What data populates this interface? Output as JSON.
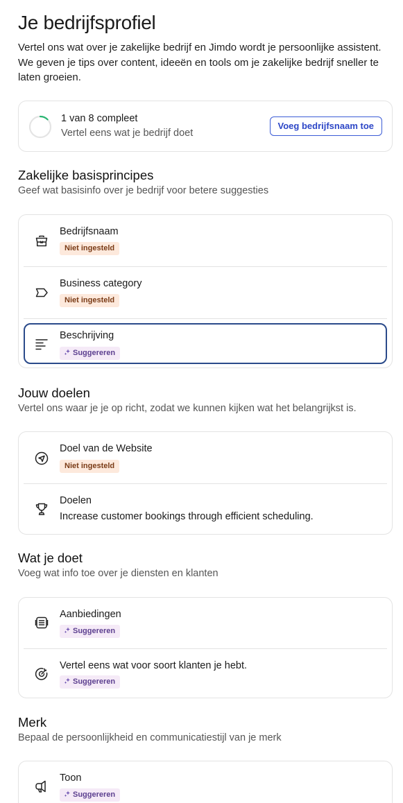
{
  "header": {
    "title": "Je bedrijfsprofiel",
    "intro": "Vertel ons wat over je zakelijke bedrijf en Jimdo wordt je persoonlijke assistent. We geven je tips over content, ideeën en tools om je zakelijke bedrijf sneller te laten groeien."
  },
  "progress": {
    "title": "1 van 8 compleet",
    "subtitle": "Vertel eens wat je bedrijf doet",
    "button_label": "Voeg bedrijfsnaam toe",
    "completed": 1,
    "total": 8,
    "ring_color": "#2bb673"
  },
  "badges": {
    "not_set": "Niet ingesteld",
    "suggest": "Suggereren"
  },
  "sections": {
    "basics": {
      "title": "Zakelijke basisprincipes",
      "subtitle": "Geef wat basisinfo over je bedrijf voor betere suggesties",
      "items": [
        {
          "label": "Bedrijfsnaam",
          "icon": "briefcase-icon"
        },
        {
          "label": "Business category",
          "icon": "tag-icon"
        },
        {
          "label": "Beschrijving",
          "icon": "text-lines-icon"
        }
      ]
    },
    "goals": {
      "title": "Jouw doelen",
      "subtitle": "Vertel ons waar je je op richt, zodat we kunnen kijken wat het belangrijkst is.",
      "items": [
        {
          "label": "Doel van de Website",
          "icon": "send-icon"
        },
        {
          "label": "Doelen",
          "value": "Increase customer bookings through efficient scheduling.",
          "icon": "trophy-icon"
        }
      ]
    },
    "work": {
      "title": "Wat je doet",
      "subtitle": "Voeg wat info toe over je diensten en klanten",
      "items": [
        {
          "label": "Aanbiedingen",
          "icon": "list-icon"
        },
        {
          "label": "Vertel eens wat voor soort klanten je hebt.",
          "icon": "target-icon"
        }
      ]
    },
    "brand": {
      "title": "Merk",
      "subtitle": "Bepaal de persoonlijkheid en communicatiestijl van je merk",
      "items": [
        {
          "label": "Toon",
          "icon": "megaphone-icon"
        }
      ]
    }
  }
}
